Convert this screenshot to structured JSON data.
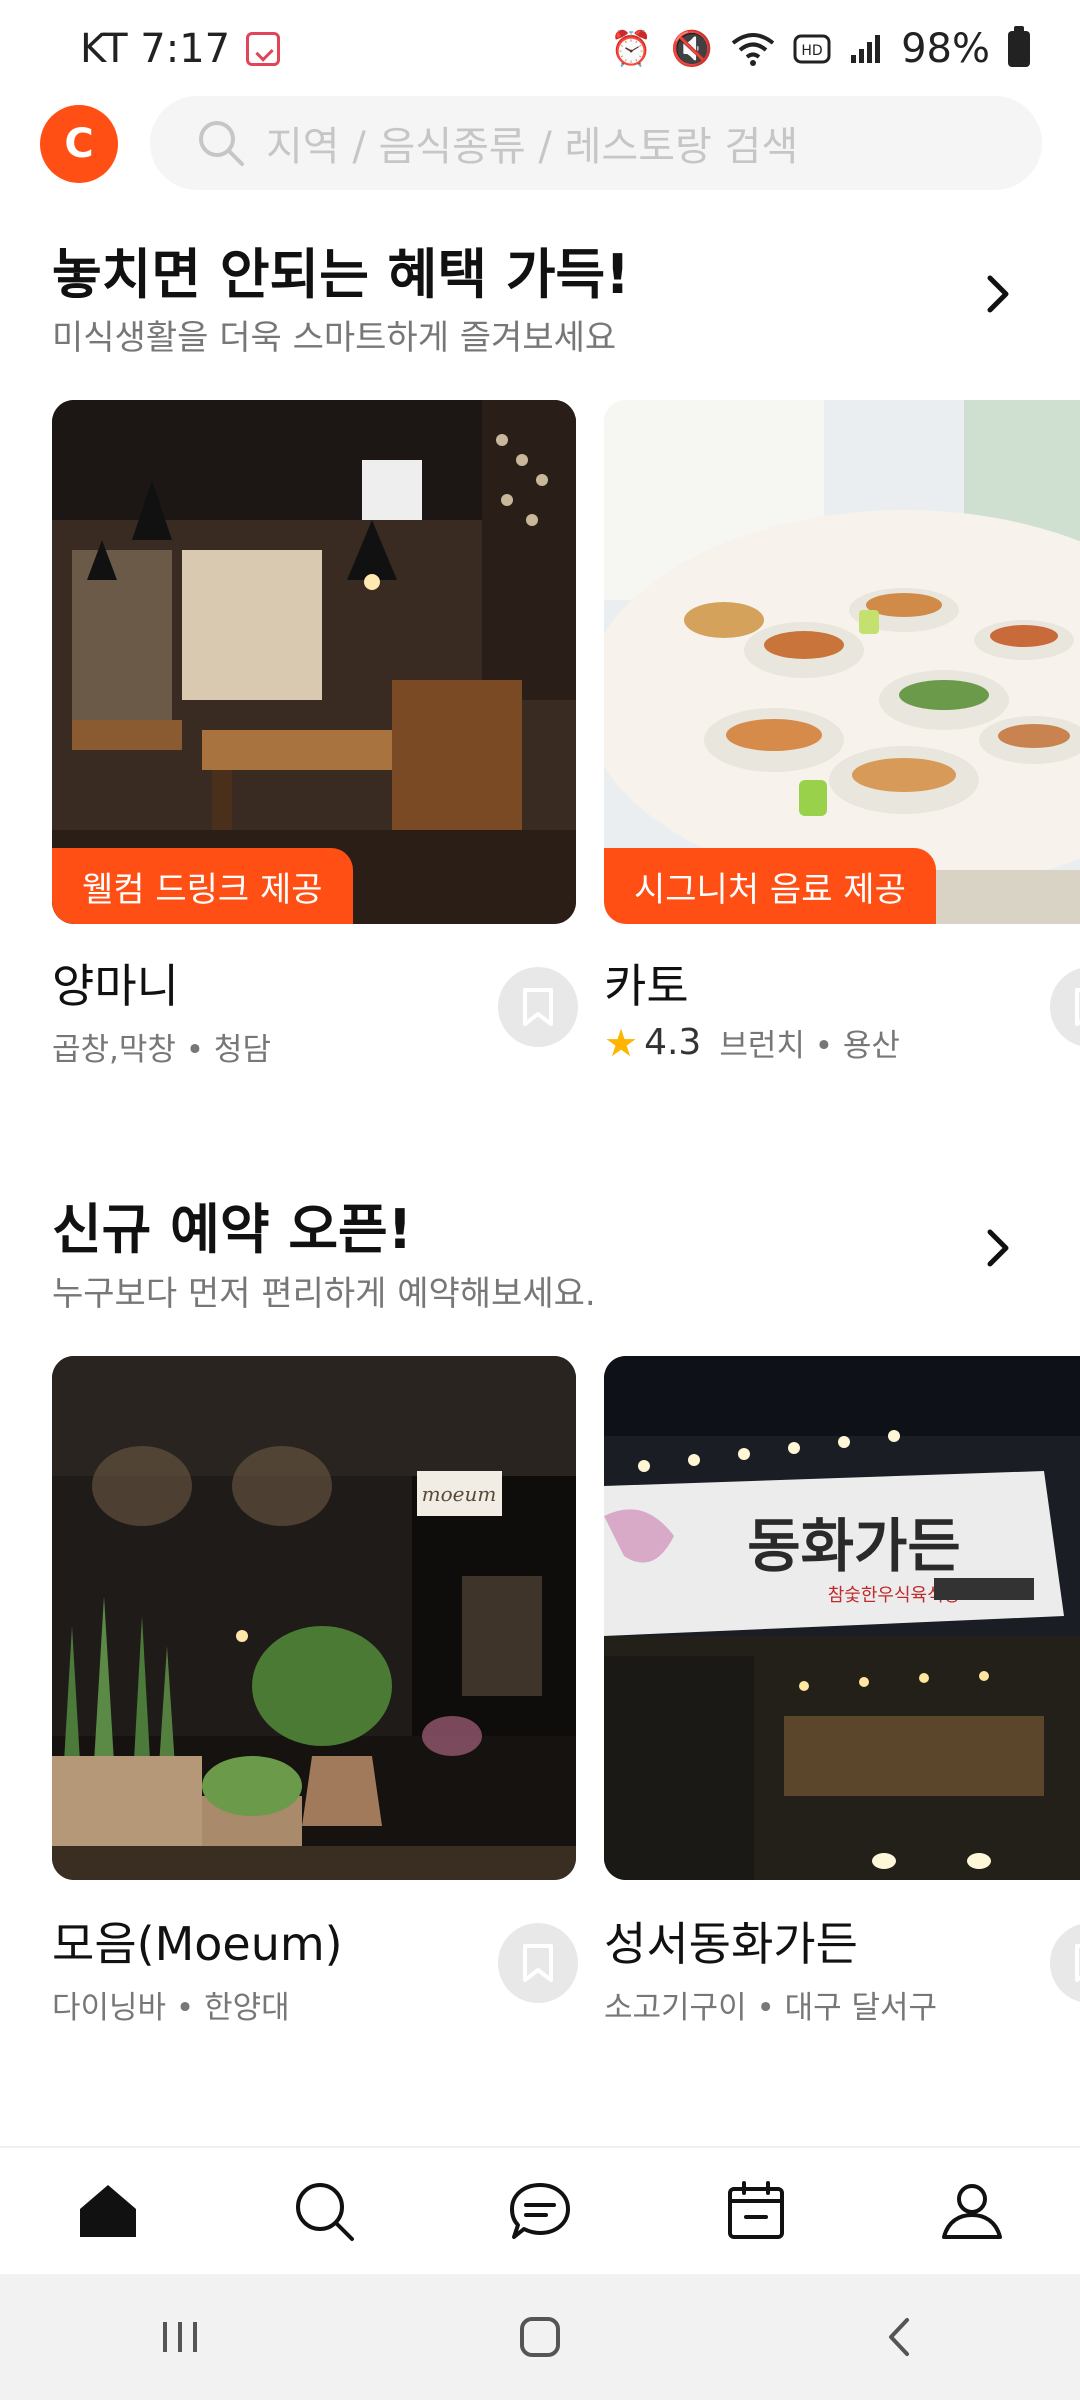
{
  "status_bar": {
    "carrier_time": "KT 7:17",
    "battery": "98%",
    "icons": [
      "calendar-check-icon",
      "alarm-icon",
      "mute-icon",
      "wifi-icon",
      "hd-icon",
      "signal-icon",
      "battery-icon"
    ]
  },
  "header": {
    "logo_letter": "C",
    "search_placeholder": "지역 / 음식종류 / 레스토랑 검색"
  },
  "sections": [
    {
      "title": "놓치면 안되는 혜택 가득!",
      "subtitle": "미식생활을 더욱 스마트하게 즐겨보세요",
      "cards": [
        {
          "badge": "웰컴 드링크 제공",
          "name": "양마니",
          "meta": "곱창,막창 • 청담"
        },
        {
          "badge": "시그니처 음료 제공",
          "name": "카토",
          "rating": "4.3",
          "meta": "브런치 • 용산"
        }
      ]
    },
    {
      "title": "신규 예약 오픈!",
      "subtitle": "누구보다 먼저 편리하게 예약해보세요.",
      "cards": [
        {
          "name": "모음(Moeum)",
          "meta": "다이닝바 • 한양대",
          "sign_text": "moeum"
        },
        {
          "name": "성서동화가든",
          "meta": "소고기구이 • 대구 달서구",
          "sign_text": "동화가든",
          "sign_sub": "참숯한우식육식당"
        }
      ]
    }
  ],
  "bottom_nav": [
    "home-icon",
    "search-icon",
    "chat-icon",
    "calendar-icon",
    "profile-icon"
  ],
  "colors": {
    "accent": "#ff4f14",
    "star": "#ffb400"
  }
}
